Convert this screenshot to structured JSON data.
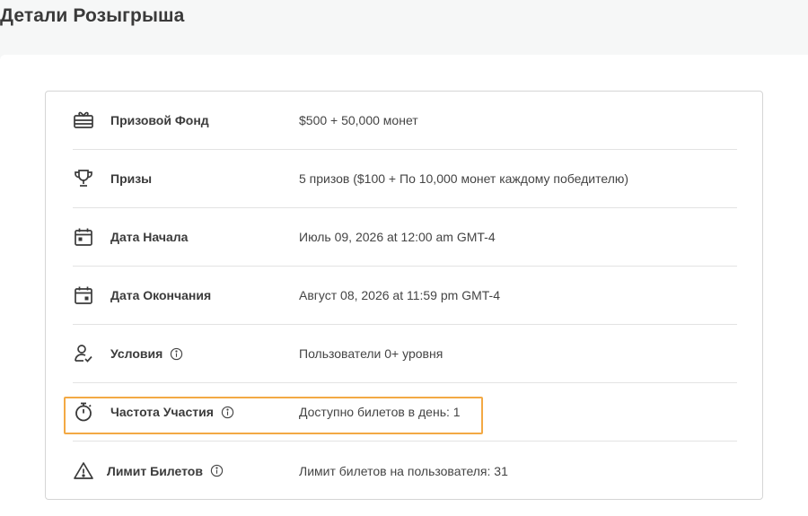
{
  "page": {
    "title": "Детали Розыгрыша"
  },
  "details": {
    "rows": [
      {
        "icon": "gift-card-icon",
        "label": "Призовой Фонд",
        "value": "$500 + 50,000 монет",
        "info": false
      },
      {
        "icon": "trophy-icon",
        "label": "Призы",
        "value": "5 призов ($100 + По 10,000 монет каждому победителю)",
        "info": false
      },
      {
        "icon": "calendar-start-icon",
        "label": "Дата Начала",
        "value": "Июль 09, 2026 at 12:00 am GMT-4",
        "info": false
      },
      {
        "icon": "calendar-end-icon",
        "label": "Дата Окончания",
        "value": "Август 08, 2026 at 11:59 pm GMT-4",
        "info": false
      },
      {
        "icon": "user-check-icon",
        "label": "Условия",
        "value": "Пользователи 0+ уровня",
        "info": true
      },
      {
        "icon": "stopwatch-icon",
        "label": "Частота Участия",
        "value": "Доступно билетов в день: 1",
        "info": true,
        "highlighted": true
      },
      {
        "icon": "warning-icon",
        "label": "Лимит Билетов",
        "value": "Лимит билетов на пользователя: 31",
        "info": true
      }
    ]
  },
  "colors": {
    "highlight": "#f3a944",
    "border": "#d5d5d5",
    "divider": "#e3e3e3"
  }
}
